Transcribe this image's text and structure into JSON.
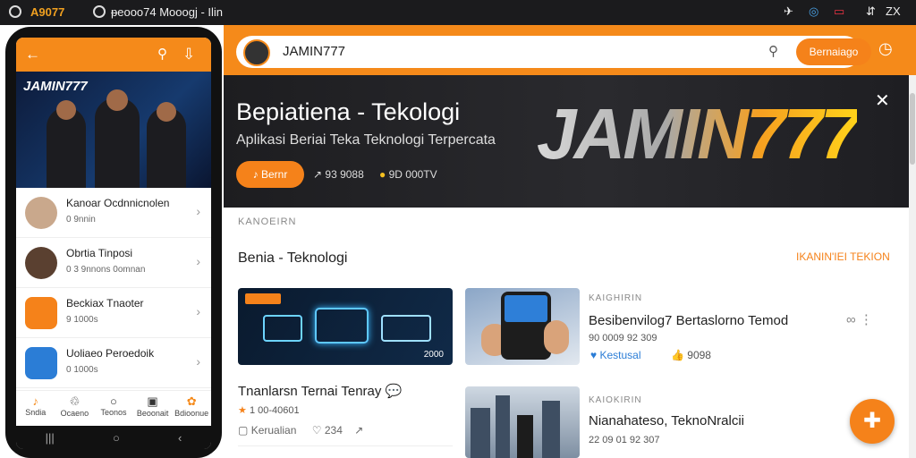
{
  "window": {
    "app_logo": "A9077",
    "title": "ᵽeooo74 Mooogj - Ilin",
    "right_icons": [
      "✈",
      "◎",
      "▭",
      "⇵",
      "ZX"
    ]
  },
  "phone": {
    "brand": "JAMIN777",
    "list": [
      {
        "name": "Kanoar Ocdnnicnolen",
        "sub": "0 9nnin"
      },
      {
        "name": "Obrtia Tinposi",
        "sub": "0 3 9nnons 0omnan"
      },
      {
        "name": "Beckiax Tnaoter",
        "sub": "9 1000s"
      },
      {
        "name": "Uoliaeo Peroedoik",
        "sub": "0 1000s"
      }
    ],
    "nav": [
      {
        "icon": "♪",
        "label": "Sndia"
      },
      {
        "icon": "♲",
        "label": "Ocaeno"
      },
      {
        "icon": "○",
        "label": "Teonos"
      },
      {
        "icon": "▣",
        "label": "Beoonait"
      },
      {
        "icon": "✿",
        "label": "Bdioonue"
      }
    ]
  },
  "browser": {
    "address": "JAMIN777",
    "button": "Bernaiago",
    "banner": {
      "title": "Bepiatiena - Tekologi",
      "subtitle": "Aplikasi Beriai Teka Teknologi Terpercata",
      "button": "Bernr",
      "stat1": "93 9088",
      "stat2": "9D 000TV",
      "logo": "JAMIN777"
    },
    "category": "KANOEIRN",
    "section_title": "Benia - Teknologi",
    "section_link": "IKANIN'IEI TEKION",
    "card1": {
      "title": "Tnanlarsn Ternai Tenray",
      "meta": "1 00-40601",
      "author": "Kerualian",
      "count": "234",
      "image_label": "2000"
    },
    "card2": {
      "kicker": "KAIGHIRIN",
      "title": "Besibenvilog7 Bertaslorno Temod",
      "meta": "90 0009 92 309",
      "like_label": "Kestusal",
      "count": "9098"
    },
    "card3": {
      "kicker": "KAIOKIRIN",
      "title": "Nianahateso, TeknoNralcii",
      "meta": "22 09 01 92 307"
    }
  }
}
